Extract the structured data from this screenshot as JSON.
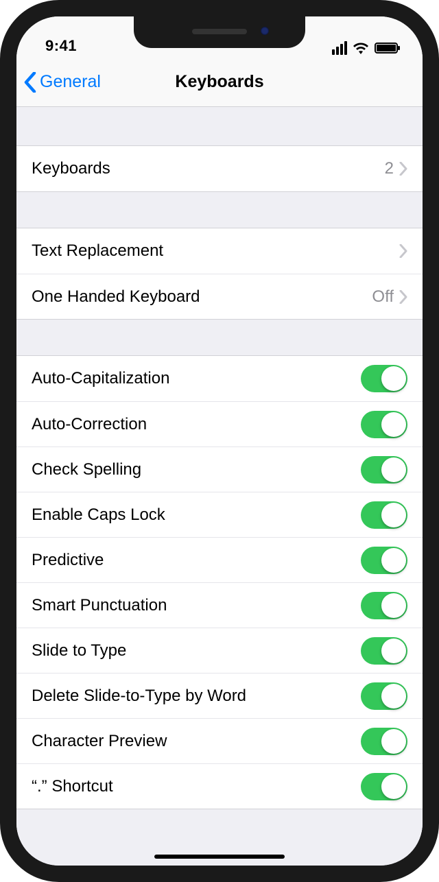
{
  "status": {
    "time": "9:41"
  },
  "nav": {
    "back_label": "General",
    "title": "Keyboards"
  },
  "group1": {
    "keyboards_label": "Keyboards",
    "keyboards_value": "2"
  },
  "group2": {
    "text_replacement_label": "Text Replacement",
    "one_handed_label": "One Handed Keyboard",
    "one_handed_value": "Off"
  },
  "toggles": [
    {
      "label": "Auto-Capitalization",
      "on": true
    },
    {
      "label": "Auto-Correction",
      "on": true
    },
    {
      "label": "Check Spelling",
      "on": true
    },
    {
      "label": "Enable Caps Lock",
      "on": true
    },
    {
      "label": "Predictive",
      "on": true
    },
    {
      "label": "Smart Punctuation",
      "on": true
    },
    {
      "label": "Slide to Type",
      "on": true
    },
    {
      "label": "Delete Slide-to-Type by Word",
      "on": true
    },
    {
      "label": "Character Preview",
      "on": true
    },
    {
      "label": "“.” Shortcut",
      "on": true
    }
  ]
}
